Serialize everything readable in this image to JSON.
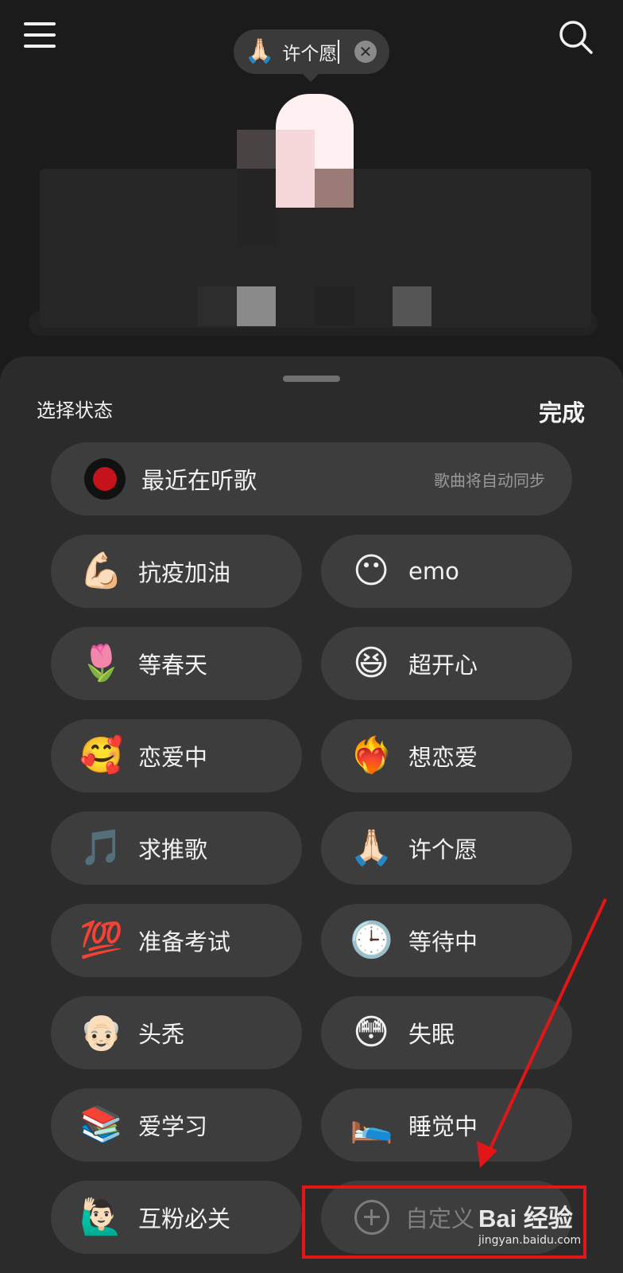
{
  "header": {
    "menu_icon": "hamburger-menu-icon",
    "search_icon": "search-icon",
    "status_pill": {
      "emoji": "🙏🏻",
      "text": "许个愿",
      "clear_icon": "clear-icon",
      "clear_glyph": "✕"
    }
  },
  "sheet": {
    "title": "选择状态",
    "done": "完成",
    "featured": {
      "label": "最近在听歌",
      "sub": "歌曲将自动同步",
      "icon": "vinyl-record-icon"
    },
    "items": [
      {
        "emoji": "💪🏻",
        "label": "抗疫加油",
        "icon": "flexed-biceps-icon"
      },
      {
        "emoji": "😶",
        "label": "emo",
        "icon": "no-mouth-face-icon"
      },
      {
        "emoji": "🌷",
        "label": "等春天",
        "icon": "tulip-icon"
      },
      {
        "emoji": "😆",
        "label": "超开心",
        "icon": "grinning-squinting-face-icon"
      },
      {
        "emoji": "🥰",
        "label": "恋爱中",
        "icon": "smiling-face-hearts-icon"
      },
      {
        "emoji": "❤️‍🔥",
        "label": "想恋爱",
        "icon": "heart-on-fire-icon"
      },
      {
        "emoji": "🎵",
        "label": "求推歌",
        "icon": "musical-note-icon"
      },
      {
        "emoji": "🙏🏻",
        "label": "许个愿",
        "icon": "folded-hands-icon"
      },
      {
        "emoji": "💯",
        "label": "准备考试",
        "icon": "hundred-points-icon"
      },
      {
        "emoji": "🕒",
        "label": "等待中",
        "icon": "clock-icon"
      },
      {
        "emoji": "👴🏻",
        "label": "头秃",
        "icon": "old-man-icon"
      },
      {
        "emoji": "😳",
        "label": "失眠",
        "icon": "flushed-face-icon"
      },
      {
        "emoji": "📚",
        "label": "爱学习",
        "icon": "books-icon"
      },
      {
        "emoji": "🛌",
        "label": "睡觉中",
        "icon": "person-in-bed-icon"
      },
      {
        "emoji": "🙋🏻‍♂️",
        "label": "互粉必关",
        "icon": "man-raising-hand-icon"
      }
    ],
    "custom": {
      "label": "自定义",
      "icon": "add-circle-icon"
    }
  },
  "annotation": {
    "color": "#e21616"
  },
  "watermark": {
    "main": "Bai 经验",
    "sub": "jingyan.baidu.com"
  }
}
